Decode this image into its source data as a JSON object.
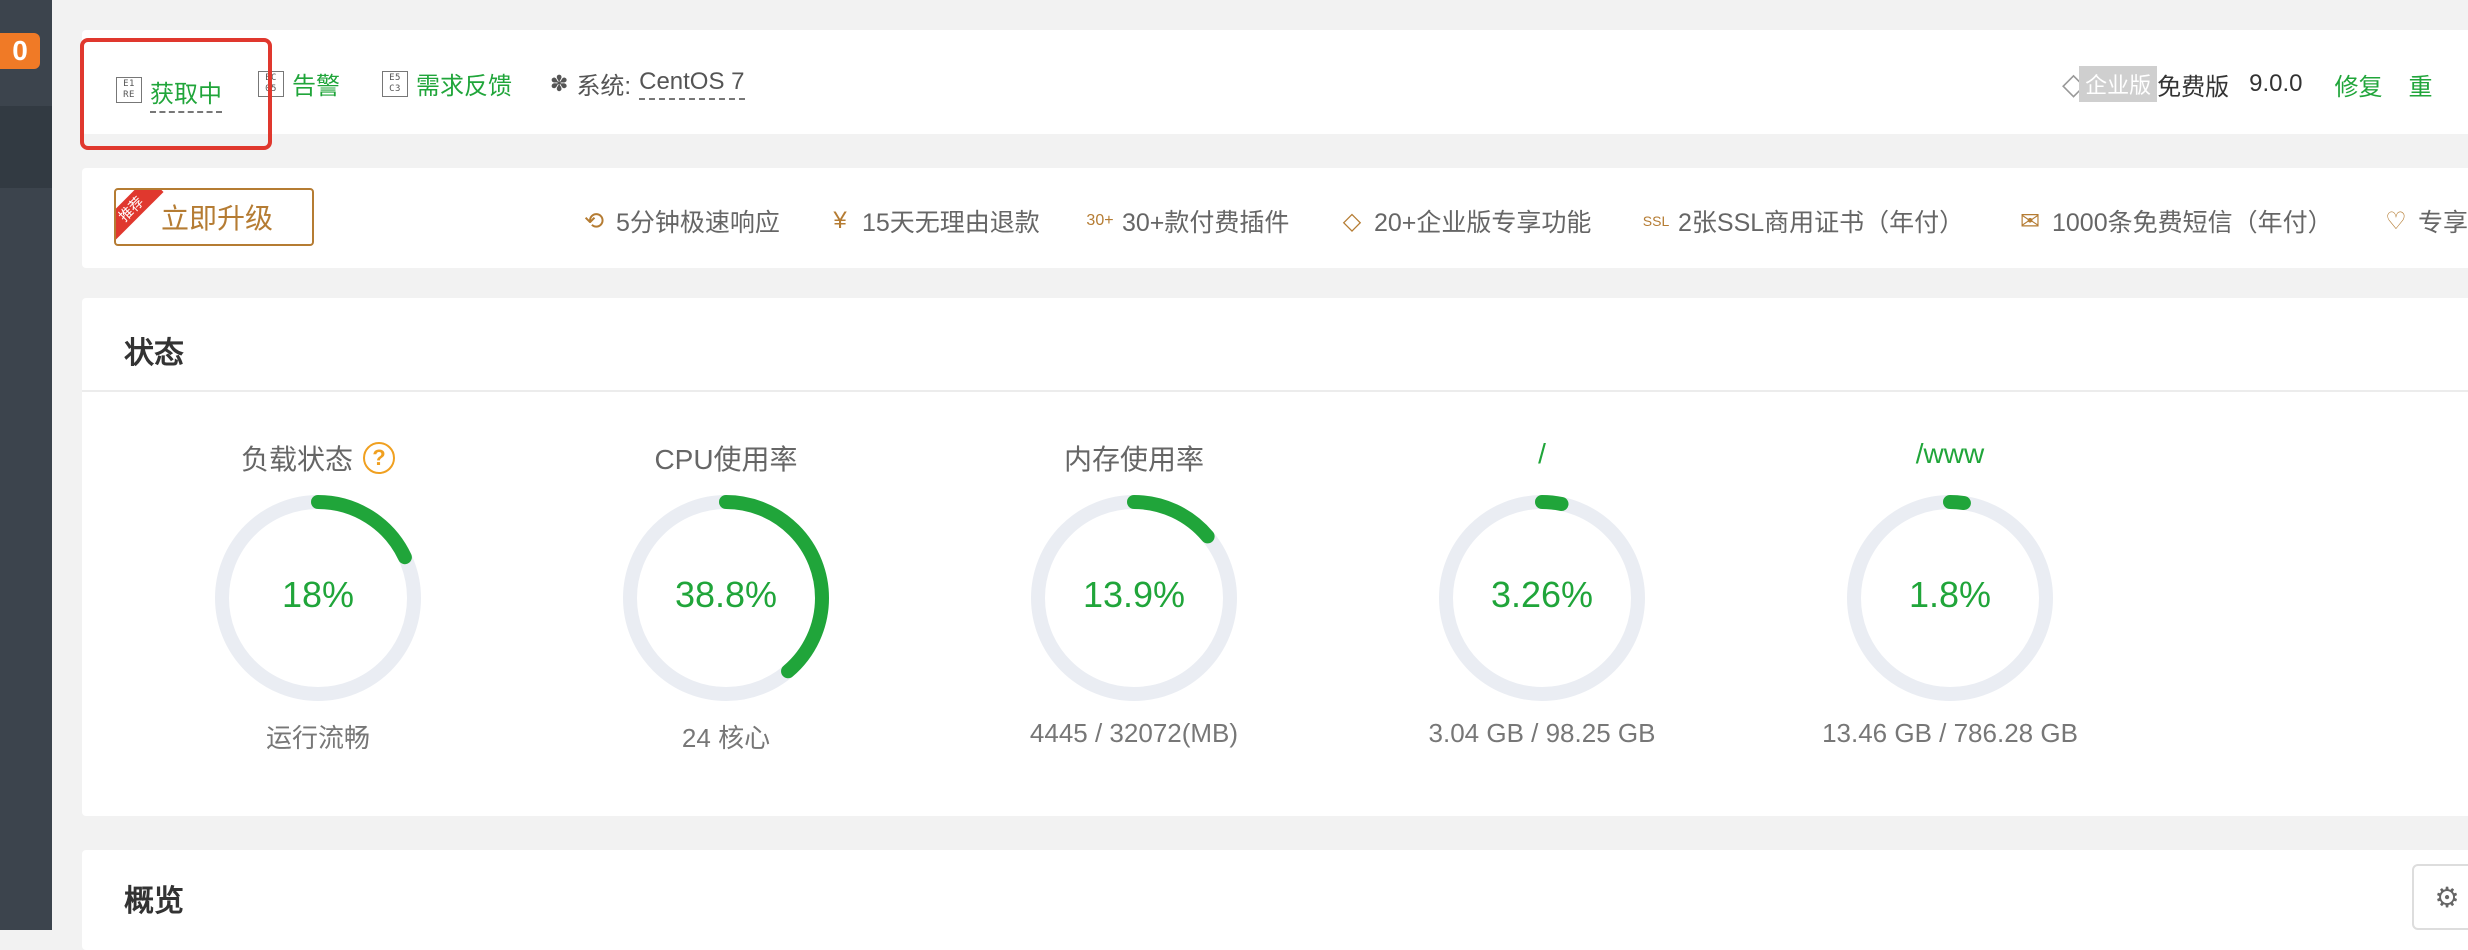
{
  "sidebar": {
    "badge": "0"
  },
  "topbar": {
    "fetch": {
      "glyph": "E1 RE",
      "label": "获取中"
    },
    "alert": {
      "glyph": "EC 05",
      "label": "告警"
    },
    "feedback": {
      "glyph": "E5 C3",
      "label": "需求反馈"
    },
    "system": {
      "prefix": "系统:",
      "value": "CentOS 7"
    },
    "enterprise_label": "企业版",
    "edition": "免费版",
    "version": "9.0.0",
    "repair": "修复",
    "restart": "重"
  },
  "upgrade": {
    "ribbon": "推荐",
    "button": "立即升级",
    "features": [
      {
        "icon": "fast-response-icon",
        "label": "5分钟极速响应"
      },
      {
        "icon": "refund-icon",
        "label": "15天无理由退款"
      },
      {
        "icon": "plugin-icon",
        "label": "30+款付费插件"
      },
      {
        "icon": "diamond-icon",
        "label": "20+企业版专享功能"
      },
      {
        "icon": "ssl-icon",
        "label": "2张SSL商用证书（年付）"
      },
      {
        "icon": "mail-icon",
        "label": "1000条免费短信（年付）"
      },
      {
        "icon": "heart-icon",
        "label": "专享"
      }
    ]
  },
  "status": {
    "title": "状态",
    "gauges": [
      {
        "title": "负载状态",
        "value": "18%",
        "percent": 18,
        "sub": "运行流畅",
        "title_green": false
      },
      {
        "title": "CPU使用率",
        "value": "38.8%",
        "percent": 38.8,
        "sub": "24 核心",
        "title_green": false
      },
      {
        "title": "内存使用率",
        "value": "13.9%",
        "percent": 13.9,
        "sub": "4445 / 32072(MB)",
        "title_green": false
      },
      {
        "title": "/",
        "value": "3.26%",
        "percent": 3.26,
        "sub": "3.04 GB / 98.25 GB",
        "title_green": true
      },
      {
        "title": "/www",
        "value": "1.8%",
        "percent": 1.8,
        "sub": "13.46 GB / 786.28 GB",
        "title_green": true
      }
    ]
  },
  "overview": {
    "title": "概览"
  },
  "colors": {
    "accent": "#20a53a",
    "track": "#eaedf3",
    "gold": "#b57c33",
    "warn": "#f0a020",
    "red": "#e0382e"
  }
}
